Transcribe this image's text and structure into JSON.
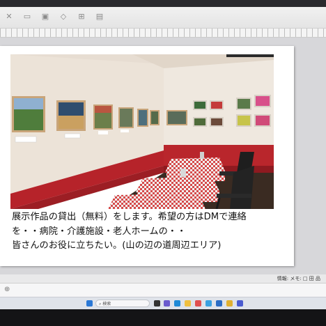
{
  "slide": {
    "caption_lines": [
      "展示作品の貸出（無料）をします。希望の方はDMで連絡",
      "を・・病院・介護施設・老人ホームの・・",
      "皆さんのお役に立ちたい。(山の辺の道周辺エリア)"
    ]
  },
  "status": {
    "right_text": "情報:  メモ:  □  田  品"
  },
  "taskbar": {
    "search_placeholder": "検索",
    "icons": [
      "windows-icon",
      "search-icon",
      "taskview-icon",
      "chat-icon",
      "edge-icon",
      "explorer-icon",
      "store-icon",
      "photos-icon",
      "mail-icon",
      "chrome-icon",
      "app-icon"
    ]
  }
}
